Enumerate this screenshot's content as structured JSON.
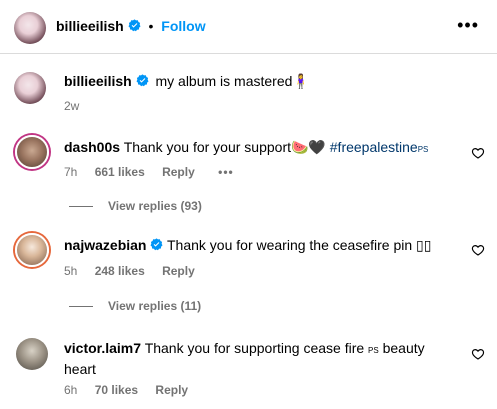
{
  "post": {
    "author": "billieeilish",
    "separator": "•",
    "follow_label": "Follow",
    "more_label": "•••",
    "caption": "my album is mastered",
    "caption_emoji": "🧍‍♀️",
    "age": "2w"
  },
  "comments": [
    {
      "user": "dash00s",
      "text": "Thank you for your support",
      "emoji": "🍉🖤",
      "hashtag": "#freepalestine",
      "hashtag_suffix": "PS",
      "time": "7h",
      "likes": "661 likes",
      "reply": "Reply",
      "options": "•••",
      "view_replies": "View replies (93)"
    },
    {
      "user": "najwazebian",
      "text": "Thank you for wearing the ceasefire pin",
      "trailing": "▯▯",
      "time": "5h",
      "likes": "248 likes",
      "reply": "Reply",
      "view_replies": "View replies (11)"
    },
    {
      "user": "victor.laim7",
      "text_line1": "Thank you for supporting cease fire",
      "ps": "PS",
      "text_line1_end": "beauty",
      "text_line2": "heart",
      "time": "6h",
      "likes": "70 likes",
      "reply": "Reply"
    }
  ],
  "colors": {
    "link_blue": "#0095f6",
    "hashtag": "#00376b",
    "meta_gray": "#737373",
    "verified_blue": "#0095f6"
  },
  "icons": [
    "verified-badge-icon",
    "more-options-icon",
    "heart-outline-icon"
  ]
}
